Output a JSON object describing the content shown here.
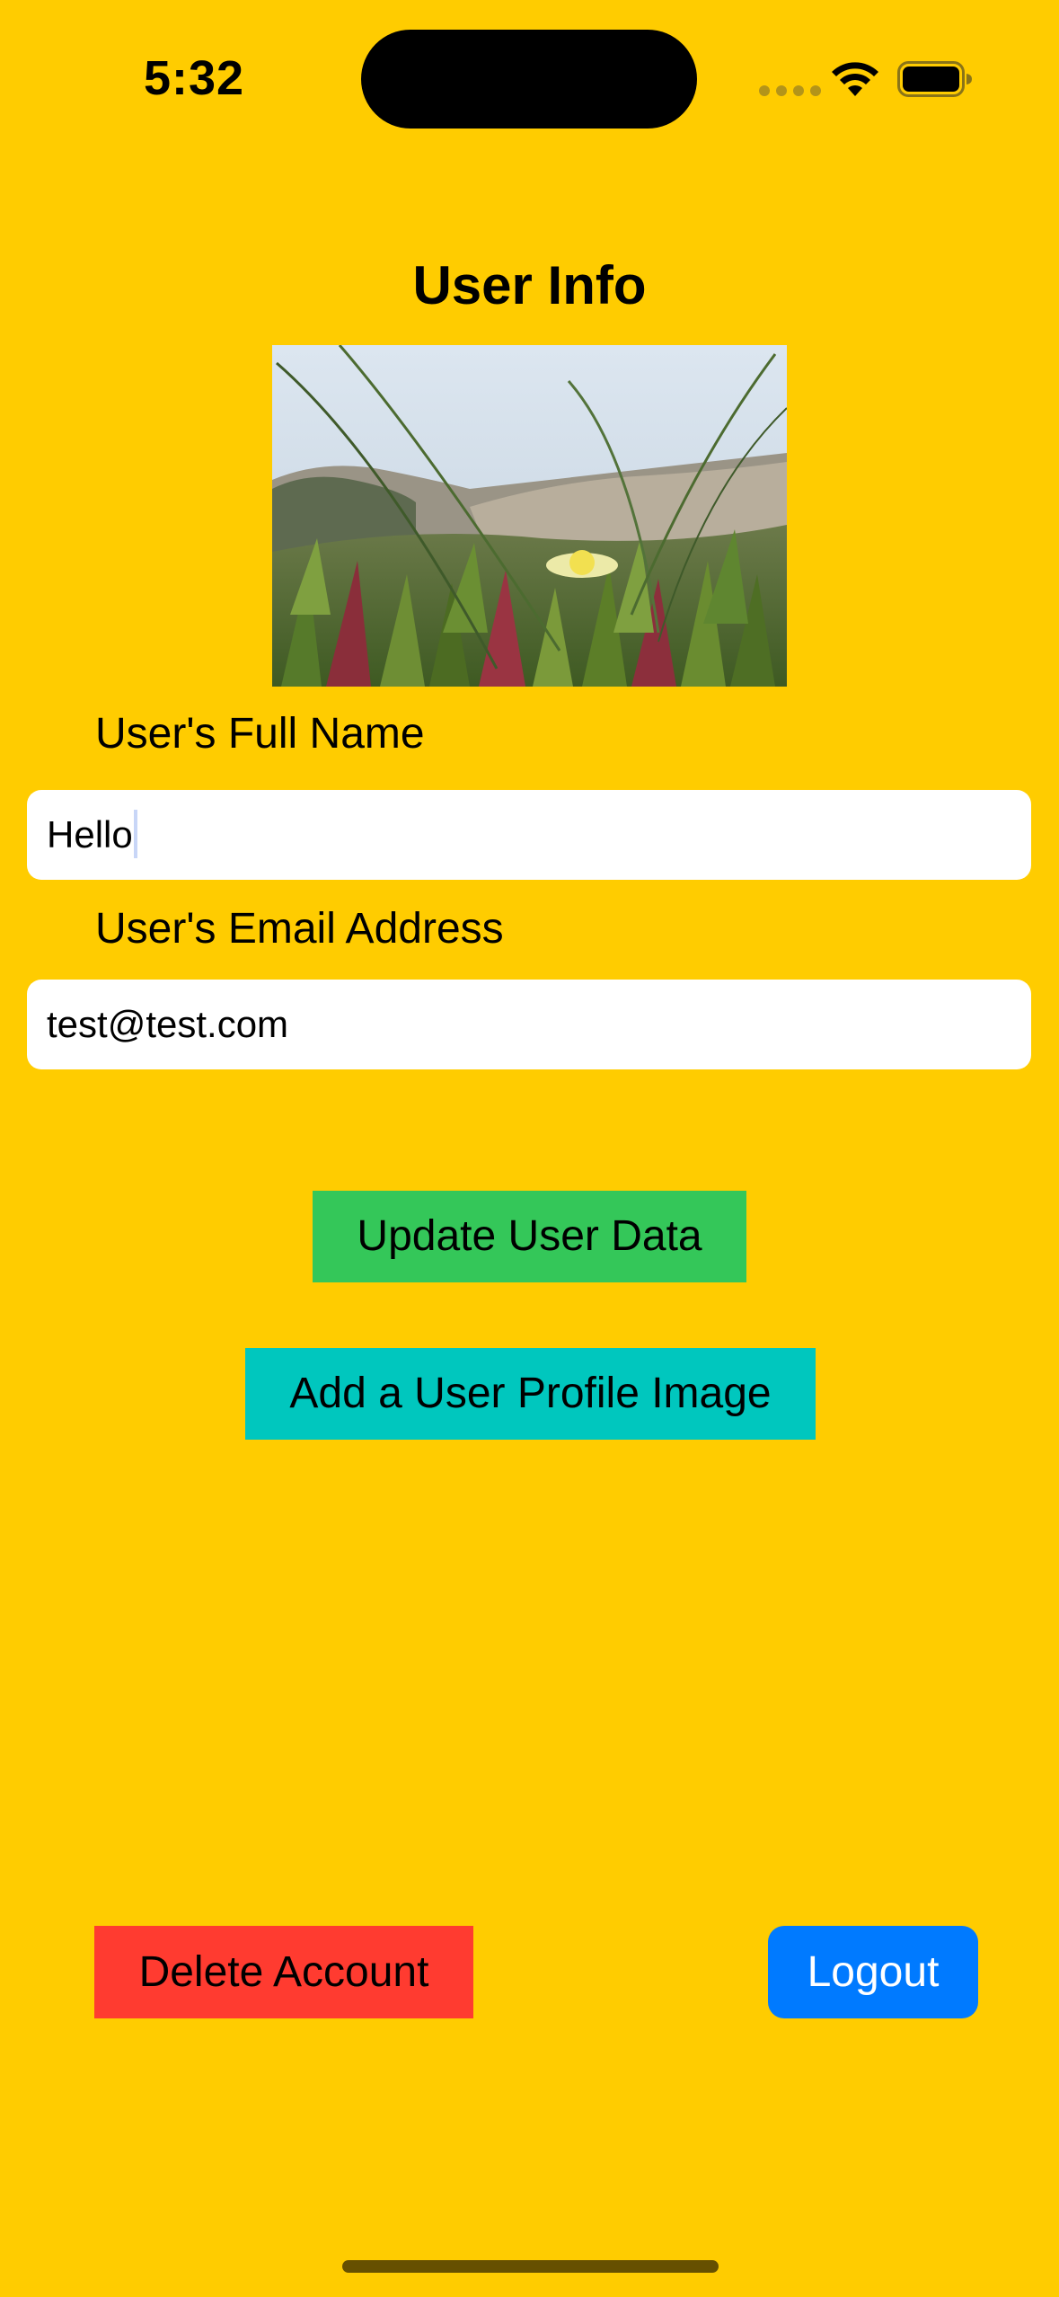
{
  "status_bar": {
    "time": "5:32"
  },
  "screen": {
    "title": "User Info",
    "background_color": "#FFCC00"
  },
  "profile_image": {
    "icon": "beach-dune-grass-flower-photo"
  },
  "form": {
    "full_name": {
      "label": "User's Full Name",
      "value": "Hello"
    },
    "email": {
      "label": "User's Email Address",
      "value": "test@test.com"
    }
  },
  "actions": {
    "update_label": "Update User Data",
    "update_color": "#34C759",
    "add_image_label": "Add a User Profile Image",
    "add_image_color": "#00C7BE",
    "delete_label": "Delete Account",
    "delete_color": "#FF3B30",
    "logout_label": "Logout",
    "logout_color": "#007AFF"
  }
}
